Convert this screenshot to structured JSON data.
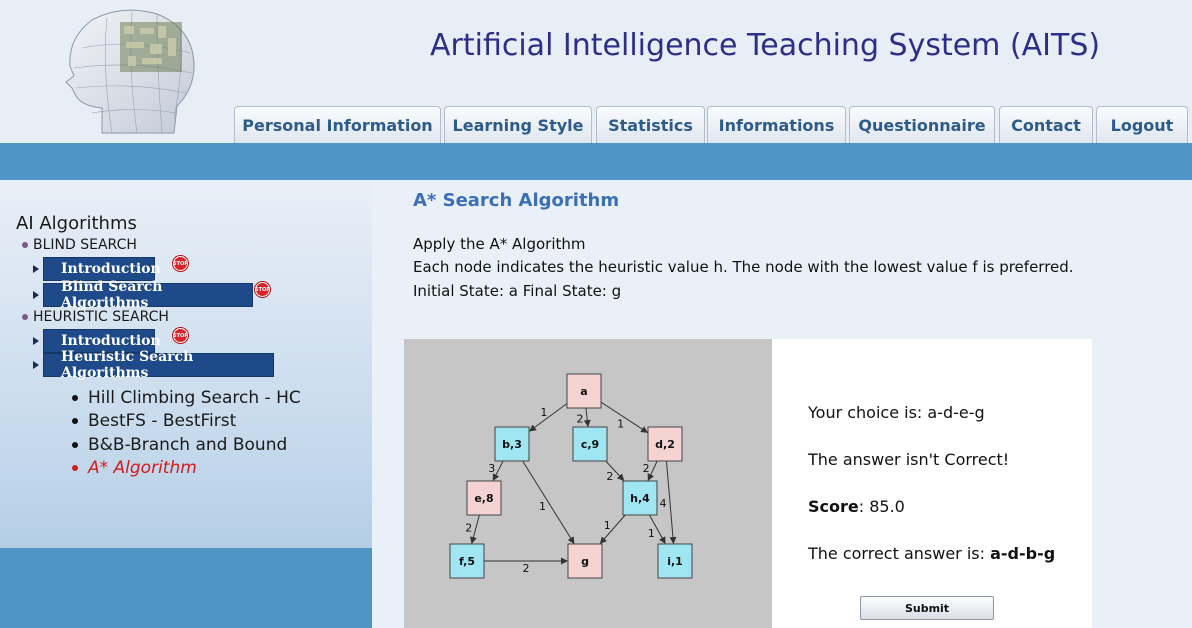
{
  "header": {
    "title": "Artificial Intelligence Teaching System (AITS)",
    "nav": [
      "Personal Information",
      "Learning Style",
      "Statistics",
      "Informations",
      "Questionnaire",
      "Contact",
      "Logout"
    ]
  },
  "sidebar": {
    "title": "AI Algorithms",
    "blind_label": "BLIND SEARCH",
    "blind_intro": "Introduction",
    "blind_algorithms": "Blind Search Algorithms",
    "heuristic_label": "HEURISTIC SEARCH",
    "heuristic_intro": "Introduction",
    "heuristic_algorithms": "Heuristic Search Algorithms",
    "stop_label": "STOP",
    "sub_items": [
      "Hill Climbing Search - HC",
      "BestFS - BestFirst",
      "B&B-Branch and Bound",
      "A* Algorithm"
    ]
  },
  "main": {
    "heading": "A* Search Algorithm",
    "line1": "Apply the A* Algorithm",
    "line2": "Each node indicates the heuristic value h. The node with the lowest value f is preferred.",
    "line3": "Initial State: a Final State: g"
  },
  "graph": {
    "nodes": [
      {
        "id": "a",
        "label": "a",
        "color": "#f6d3d3"
      },
      {
        "id": "b",
        "label": "b,3",
        "color": "#9fe6f2"
      },
      {
        "id": "c",
        "label": "c,9",
        "color": "#9fe6f2"
      },
      {
        "id": "d",
        "label": "d,2",
        "color": "#f6d3d3"
      },
      {
        "id": "e",
        "label": "e,8",
        "color": "#f6d3d3"
      },
      {
        "id": "h",
        "label": "h,4",
        "color": "#9fe6f2"
      },
      {
        "id": "f",
        "label": "f,5",
        "color": "#9fe6f2"
      },
      {
        "id": "g",
        "label": "g",
        "color": "#f6d3d3"
      },
      {
        "id": "i",
        "label": "i,1",
        "color": "#9fe6f2"
      }
    ],
    "edges": [
      {
        "from": "a",
        "to": "b",
        "weight": "1"
      },
      {
        "from": "a",
        "to": "c",
        "weight": "2"
      },
      {
        "from": "a",
        "to": "d",
        "weight": "1"
      },
      {
        "from": "b",
        "to": "e",
        "weight": "3"
      },
      {
        "from": "b",
        "to": "g",
        "weight": "1"
      },
      {
        "from": "c",
        "to": "h",
        "weight": "2"
      },
      {
        "from": "d",
        "to": "h",
        "weight": "2"
      },
      {
        "from": "d",
        "to": "i",
        "weight": "4"
      },
      {
        "from": "e",
        "to": "f",
        "weight": "2"
      },
      {
        "from": "f",
        "to": "g",
        "weight": "2"
      },
      {
        "from": "h",
        "to": "g",
        "weight": "1"
      },
      {
        "from": "h",
        "to": "i",
        "weight": "1"
      }
    ]
  },
  "result": {
    "choice_label": "Your choice is: ",
    "choice_value": "a-d-e-g",
    "status": "The answer isn't Correct!",
    "score_label": "Score",
    "score_value": ": 85.0",
    "correct_label": "The correct answer is: ",
    "correct_value": "a-d-b-g",
    "submit_label": "Submit"
  }
}
